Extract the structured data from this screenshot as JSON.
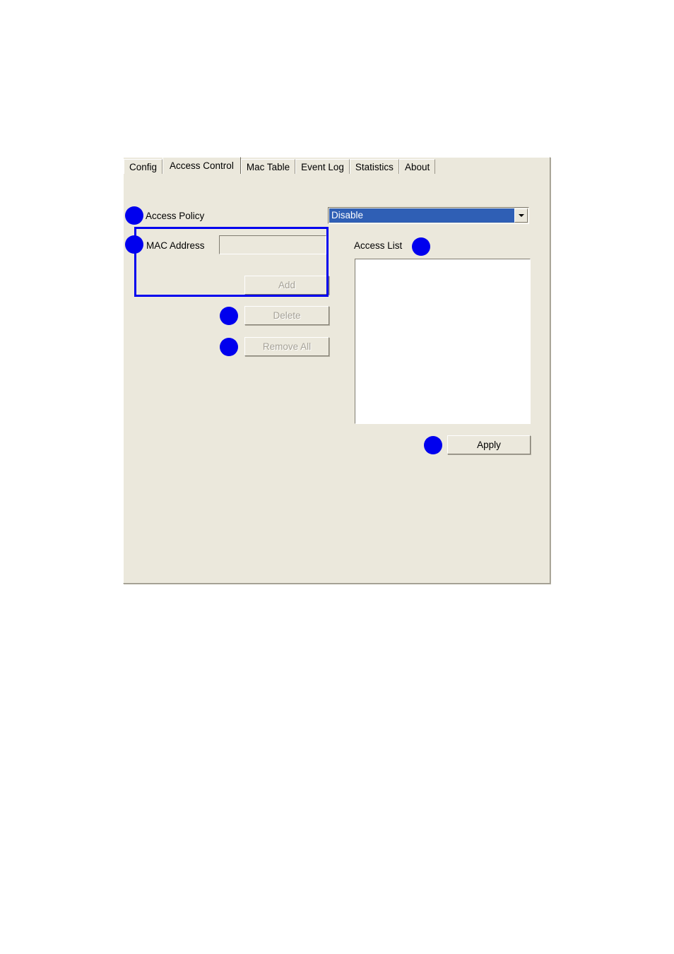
{
  "dialog": {
    "tabs": [
      {
        "label": "Config",
        "selected": false
      },
      {
        "label": "Access Control",
        "selected": true
      },
      {
        "label": "Mac Table",
        "selected": false
      },
      {
        "label": "Event Log",
        "selected": false
      },
      {
        "label": "Statistics",
        "selected": false
      },
      {
        "label": "About",
        "selected": false
      }
    ],
    "fields": {
      "access_policy_label": "Access Policy",
      "access_policy_value": "Disable",
      "access_policy_options": [
        "Disable"
      ],
      "mac_address_label": "MAC Address",
      "mac_address_value": "",
      "mac_address_placeholder": "",
      "access_list_label": "Access List",
      "access_list_items": []
    },
    "buttons": {
      "add": "Add",
      "delete": "Delete",
      "remove_all": "Remove All",
      "apply": "Apply"
    },
    "button_states": {
      "add": "disabled",
      "delete": "disabled",
      "remove_all": "disabled",
      "apply": "enabled"
    }
  },
  "annotations": {
    "color": "#0000ee",
    "dots": [
      {
        "name": "access-policy-callout"
      },
      {
        "name": "mac-address-callout"
      },
      {
        "name": "access-list-callout"
      },
      {
        "name": "delete-callout"
      },
      {
        "name": "remove-all-callout"
      },
      {
        "name": "apply-callout"
      }
    ],
    "boxes": [
      {
        "name": "mac-address-group-highlight"
      }
    ]
  },
  "colors": {
    "dialog_background": "#ebe8dc",
    "combo_highlight": "#2f5fb5",
    "annotation_blue": "#0000ee",
    "listbox_background": "#ffffff",
    "disabled_text": "#a5a196"
  }
}
